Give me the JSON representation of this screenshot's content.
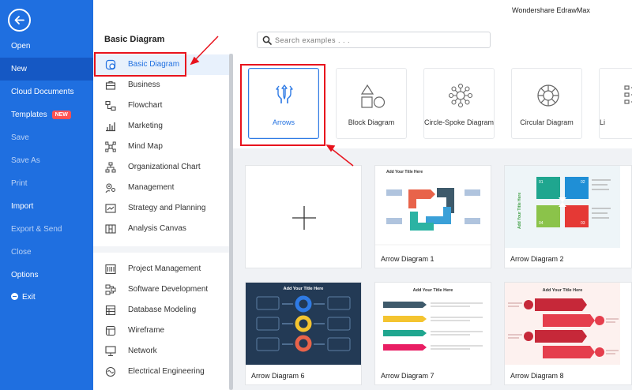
{
  "app": {
    "title": "Wondershare EdrawMax"
  },
  "leftnav": {
    "items": [
      {
        "label": "Open",
        "state": "normal"
      },
      {
        "label": "New",
        "state": "active"
      },
      {
        "label": "Cloud Documents",
        "state": "normal"
      },
      {
        "label": "Templates",
        "state": "normal",
        "badge": "NEW"
      },
      {
        "label": "Save",
        "state": "dim"
      },
      {
        "label": "Save As",
        "state": "dim"
      },
      {
        "label": "Print",
        "state": "dim"
      },
      {
        "label": "Import",
        "state": "normal"
      },
      {
        "label": "Export & Send",
        "state": "dim"
      },
      {
        "label": "Close",
        "state": "dim"
      },
      {
        "label": "Options",
        "state": "normal"
      },
      {
        "label": "Exit",
        "state": "normal"
      }
    ]
  },
  "category": {
    "title": "Basic Diagram",
    "items": [
      {
        "label": "Basic Diagram",
        "icon": "basic-diagram-icon"
      },
      {
        "label": "Business",
        "icon": "briefcase-icon"
      },
      {
        "label": "Flowchart",
        "icon": "flowchart-icon"
      },
      {
        "label": "Marketing",
        "icon": "bar-chart-icon"
      },
      {
        "label": "Mind Map",
        "icon": "mind-map-icon"
      },
      {
        "label": "Organizational Chart",
        "icon": "org-chart-icon"
      },
      {
        "label": "Management",
        "icon": "gear-people-icon"
      },
      {
        "label": "Strategy and Planning",
        "icon": "strategy-icon"
      },
      {
        "label": "Analysis Canvas",
        "icon": "canvas-icon"
      }
    ],
    "items2": [
      {
        "label": "Project Management",
        "icon": "project-icon"
      },
      {
        "label": "Software Development",
        "icon": "software-icon"
      },
      {
        "label": "Database Modeling",
        "icon": "database-icon"
      },
      {
        "label": "Wireframe",
        "icon": "wireframe-icon"
      },
      {
        "label": "Network",
        "icon": "network-icon"
      },
      {
        "label": "Electrical Engineering",
        "icon": "electrical-icon"
      }
    ]
  },
  "search": {
    "placeholder": "Search examples . . ."
  },
  "basic_templates": [
    {
      "label": "Arrows",
      "icon": "arrows-icon",
      "selected": true
    },
    {
      "label": "Block Diagram",
      "icon": "block-diagram-icon"
    },
    {
      "label": "Circle-Spoke Diagram",
      "icon": "circle-spoke-icon"
    },
    {
      "label": "Circular Diagram",
      "icon": "circular-diagram-icon"
    },
    {
      "label": "Li",
      "icon": "list-icon"
    }
  ],
  "gallery": [
    {
      "label": "",
      "type": "blank"
    },
    {
      "label": "Arrow Diagram 1",
      "thumb_title": "Add Your Title Here"
    },
    {
      "label": "Arrow Diagram 2",
      "thumb_title": "Add Your Title Here"
    },
    {
      "label": "Arrow Diagram 6",
      "thumb_title": "Add Your Title Here"
    },
    {
      "label": "Arrow Diagram 7",
      "thumb_title": "Add Your Title Here"
    },
    {
      "label": "Arrow Diagram 8",
      "thumb_title": "Add Your Title Here"
    }
  ],
  "colors": {
    "accent": "#1f6fe0",
    "annotation": "#e8131d"
  }
}
